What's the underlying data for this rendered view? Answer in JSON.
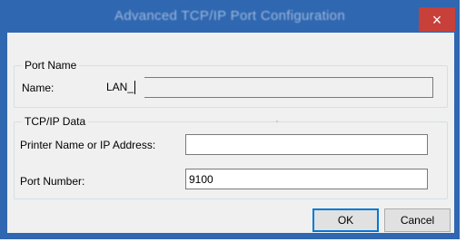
{
  "window": {
    "title": "Advanced TCP/IP Port Configuration",
    "close_label": "×"
  },
  "port_name_group": {
    "legend": "Port Name",
    "name_label": "Name:",
    "name_value": "LAN_"
  },
  "tcpip_group": {
    "legend": "TCP/IP Data",
    "address_label": "Printer Name or IP Address:",
    "address_value": "",
    "port_label": "Port Number:",
    "port_value": "9100"
  },
  "buttons": {
    "ok_label": "OK",
    "cancel_label": "Cancel"
  },
  "colors": {
    "titlebar": "#2f67b1",
    "close_button": "#c7403a",
    "client_area": "#f0f0f0"
  }
}
